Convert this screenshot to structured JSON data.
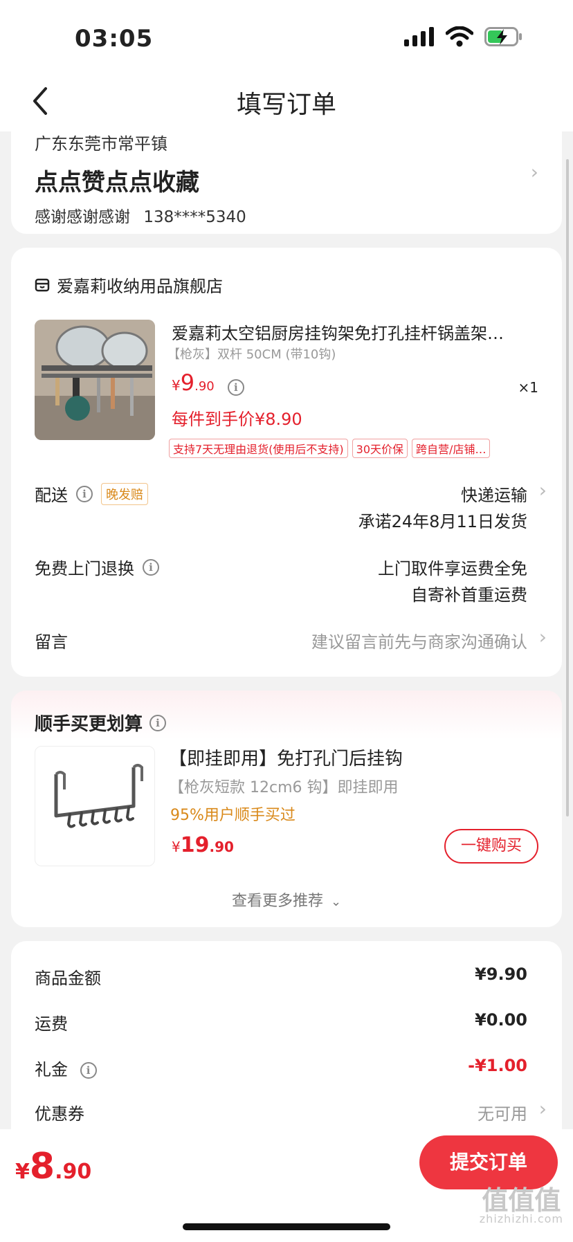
{
  "status_bar": {
    "time": "03:05"
  },
  "nav": {
    "title": "填写订单"
  },
  "address": {
    "region": "广东东莞市常平镇",
    "detail": "点点赞点点收藏",
    "name": "感谢感谢感谢",
    "phone": "138****5340"
  },
  "store": {
    "name": "爱嘉莉收纳用品旗舰店",
    "product": {
      "title": "爱嘉莉太空铝厨房挂钩架免打孔挂杆锅盖架…",
      "spec": "【枪灰】双杆 50CM (带10钩)",
      "price_symbol": "¥",
      "price_int": "9",
      "price_dec": ".90",
      "quantity": "×1",
      "final_price": "每件到手价¥8.90",
      "tags": [
        "支持7天无理由退货(使用后不支持)",
        "30天价保",
        "跨自营/店铺…"
      ]
    },
    "delivery": {
      "label": "配送",
      "badge": "晚发赔",
      "method": "快递运输",
      "promise": "承诺24年8月11日发货"
    },
    "return_service": {
      "label": "免费上门退换",
      "line1": "上门取件享运费全免",
      "line2": "自寄补首重运费"
    },
    "message": {
      "label": "留言",
      "placeholder": "建议留言前先与商家沟通确认"
    }
  },
  "addon": {
    "title": "顺手买更划算",
    "product": {
      "title": "【即挂即用】免打孔门后挂钩",
      "spec": "【枪灰短款 12cm6 钩】即挂即用",
      "social": "95%用户顺手买过",
      "price_symbol": "¥",
      "price_int": "19",
      "price_dec": ".90",
      "buy_label": "一键购买"
    },
    "more_label": "查看更多推荐"
  },
  "summary": {
    "rows": [
      {
        "label": "商品金额",
        "value": "¥9.90"
      },
      {
        "label": "运费",
        "value": "¥0.00"
      },
      {
        "label": "礼金",
        "value": "-¥1.00"
      },
      {
        "label": "优惠券",
        "value": "无可用"
      }
    ]
  },
  "footer": {
    "total_symbol": "¥",
    "total_int": "8",
    "total_dec": ".90",
    "submit_label": "提交订单"
  },
  "watermark": {
    "text": "值值值",
    "url": "zhizhizhi.com"
  },
  "colors": {
    "accent_red": "#e4202c",
    "orange": "#d9891a",
    "submit_bg": "#ee3640"
  }
}
